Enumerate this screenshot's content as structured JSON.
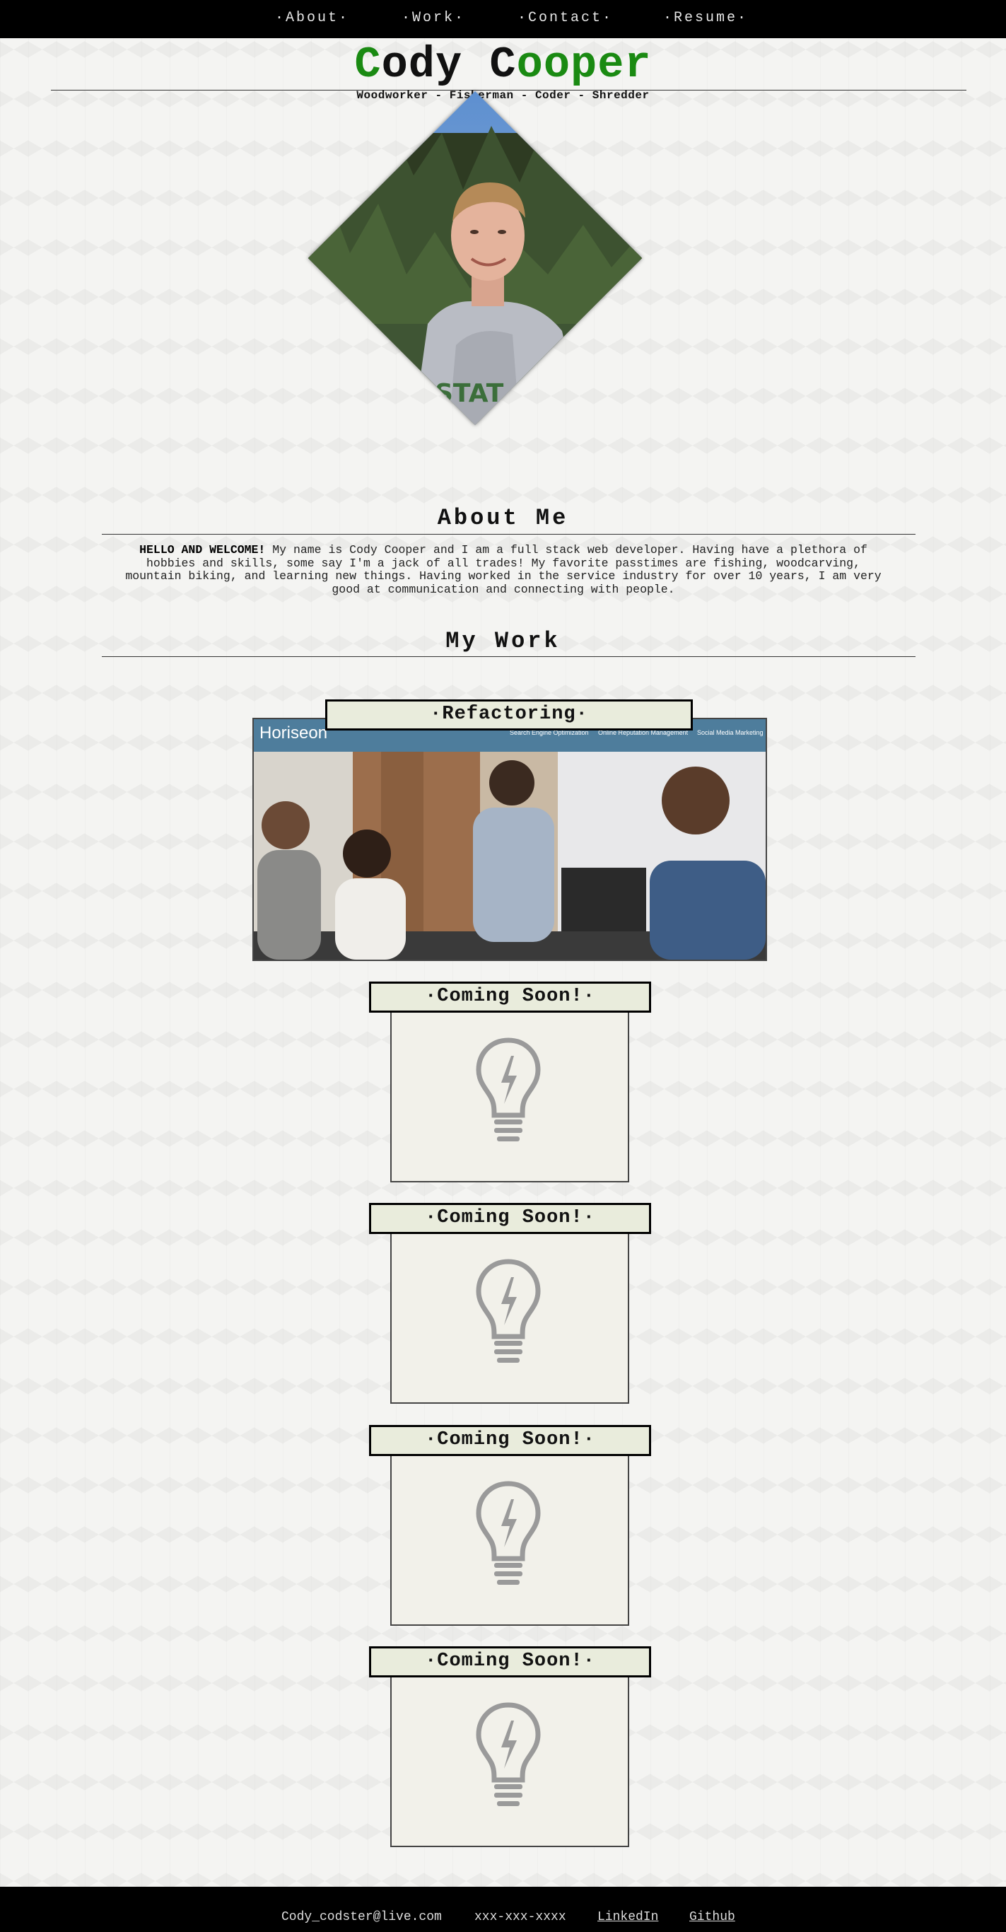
{
  "nav": {
    "items": [
      {
        "label": "·About·"
      },
      {
        "label": "·Work·"
      },
      {
        "label": "·Contact·"
      },
      {
        "label": "·Resume·"
      }
    ]
  },
  "header": {
    "title_parts": [
      "C",
      "ody",
      " C",
      "ooper"
    ],
    "subtitle": "Woodworker - Fisherman - Coder - Shredder"
  },
  "portrait": {
    "icon": "profile-photo"
  },
  "about": {
    "heading": "About Me",
    "lead": "HELLO AND WELCOME!",
    "body": " My name is Cody Cooper and I am a full stack web developer. Having have a plethora of hobbies and skills, some say I'm a jack of all trades! My favorite passtimes are fishing, woodcarving, mountain biking, and learning new things. Having worked in the service industry for over 10 years, I am very good at communication and connecting with people."
  },
  "work": {
    "heading": "My Work",
    "featured": {
      "label": "·Refactoring·",
      "screenshot": {
        "brand": "Horiseon",
        "nav": [
          "Search Engine Optimization",
          "Online Reputation Management",
          "Social Media Marketing"
        ]
      }
    },
    "placeholders": [
      {
        "label": "·Coming Soon!·",
        "icon": "lightbulb-icon"
      },
      {
        "label": "·Coming Soon!·",
        "icon": "lightbulb-icon"
      },
      {
        "label": "·Coming Soon!·",
        "icon": "lightbulb-icon"
      },
      {
        "label": "·Coming Soon!·",
        "icon": "lightbulb-icon"
      }
    ]
  },
  "footer": {
    "email": "Cody_codster@live.com",
    "phone": "xxx-xxx-xxxx",
    "linkedin": "LinkedIn",
    "github": "Github"
  },
  "colors": {
    "accent_green": "#1a8a12",
    "nav_bg": "#000000",
    "card_label_bg": "#e9ecdc"
  }
}
